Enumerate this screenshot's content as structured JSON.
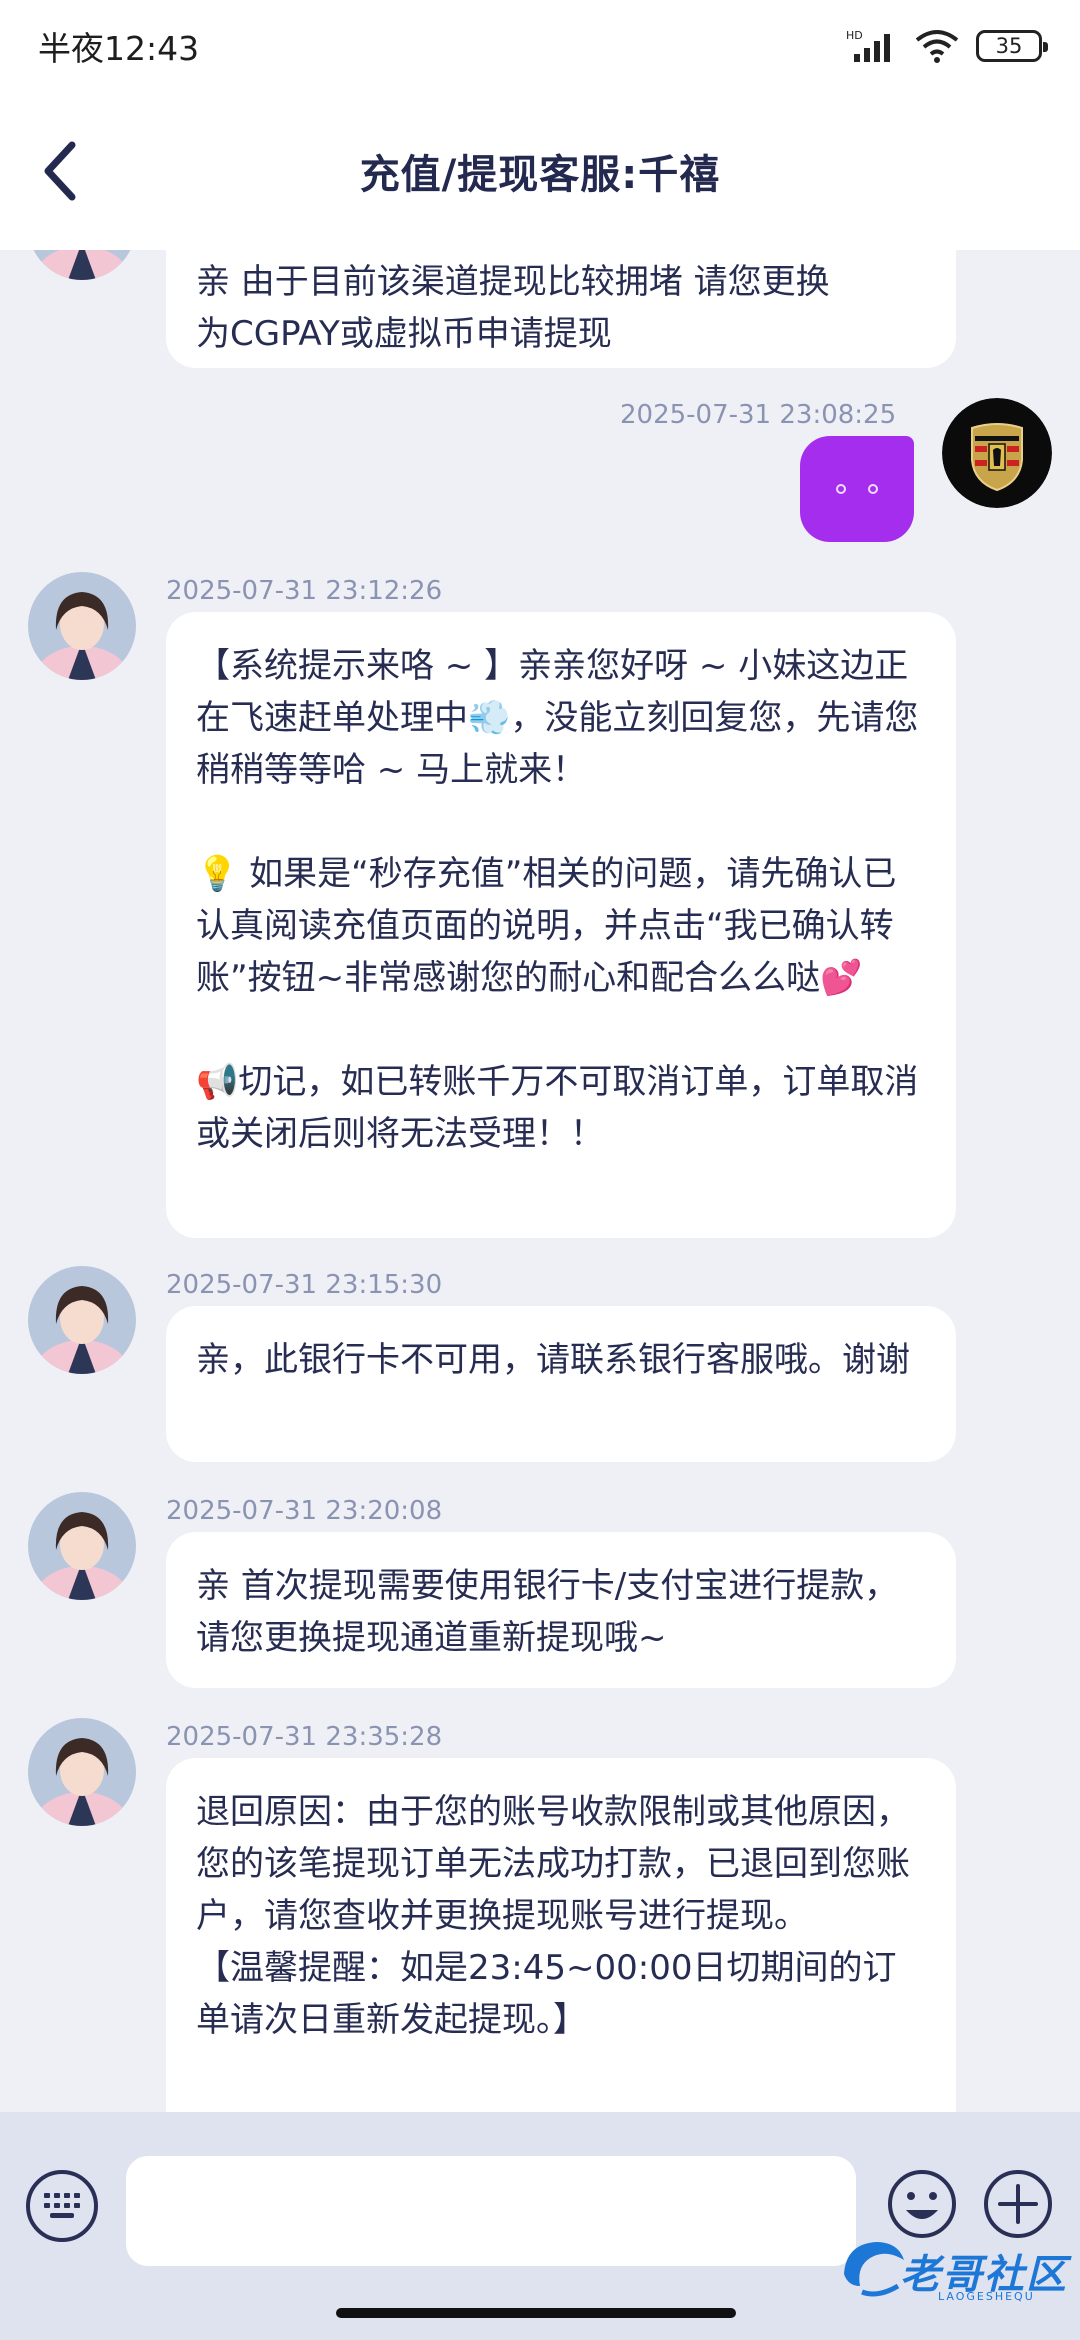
{
  "status_bar": {
    "time": "半夜12:43",
    "network": "HD",
    "battery": "35"
  },
  "header": {
    "title": "充值/提现客服:千禧"
  },
  "messages": {
    "m0": {
      "sender": "agent",
      "text": "亲 由于目前该渠道提现比较拥堵 请您更换\n为CGPAY或虚拟币申请提现"
    },
    "m1": {
      "sender": "user",
      "timestamp": "2025-07-31 23:08:25",
      "text": "。。"
    },
    "m2": {
      "sender": "agent",
      "timestamp": "2025-07-31 23:12:26",
      "text": "【系统提示来咯 ~ 】亲亲您好呀 ~ 小妹这边正在飞速赶单处理中💨，没能立刻回复您，先请您稍稍等等哈 ~ 马上就来！\n\n💡 如果是“秒存充值”相关的问题，请先确认已认真阅读充值页面的说明，并点击“我已确认转账”按钮~非常感谢您的耐心和配合么么哒💕\n\n📢切记，如已转账千万不可取消订单，订单取消或关闭后则将无法受理！！"
    },
    "m3": {
      "sender": "agent",
      "timestamp": "2025-07-31 23:15:30",
      "text": "亲，此银行卡不可用，请联系银行客服哦。谢谢"
    },
    "m4": {
      "sender": "agent",
      "timestamp": "2025-07-31 23:20:08",
      "text": "亲 首次提现需要使用银行卡/支付宝进行提款，请您更换提现通道重新提现哦~"
    },
    "m5": {
      "sender": "agent",
      "timestamp": "2025-07-31 23:35:28",
      "text": "退回原因：由于您的账号收款限制或其他原因，您的该笔提现订单无法成功打款，已退回到您账户，请您查收并更换提现账号进行提现。\n【温馨提醒：如是23:45~00:00日切期间的订单请次日重新发起提现。】"
    }
  },
  "input_bar": {
    "placeholder": ""
  },
  "watermark": {
    "text": "老哥社区",
    "sub": "LAOGESHEQU"
  },
  "colors": {
    "outgoing_bubble": "#a52ded",
    "incoming_bubble": "#ffffff",
    "background": "#eef0f5",
    "timestamp": "#8b93b3",
    "title": "#24294f"
  },
  "icons": [
    "signal-icon",
    "wifi-icon",
    "battery-icon",
    "back-arrow-icon",
    "keyboard-icon",
    "emoji-icon",
    "plus-icon",
    "avatar-agent",
    "avatar-user-porsche-logo"
  ]
}
